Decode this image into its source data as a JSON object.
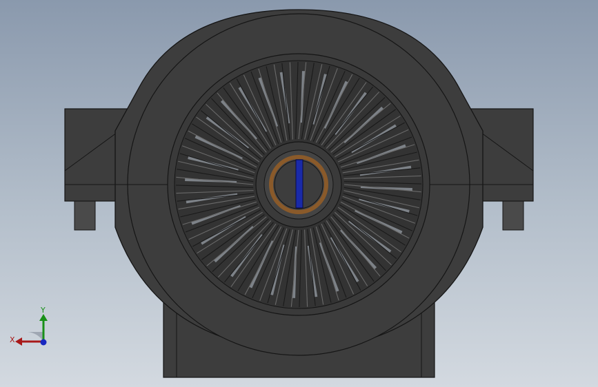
{
  "viewport": {
    "background_top": "#8a99ad",
    "background_bottom": "#d3d9e0"
  },
  "model": {
    "body_color": "#3d3d3d",
    "edge_color": "#151515",
    "blade_color": "#5a5a5a",
    "gap_color": "#b9c2ce",
    "hub_ring_color": "#8a5a2a",
    "shaft_key_color": "#1a2aa8",
    "blade_count": 96
  },
  "triad": {
    "x_label": "X",
    "y_label": "Y",
    "x_color": "#a81818",
    "y_color": "#189018",
    "z_color": "#1828c0"
  }
}
